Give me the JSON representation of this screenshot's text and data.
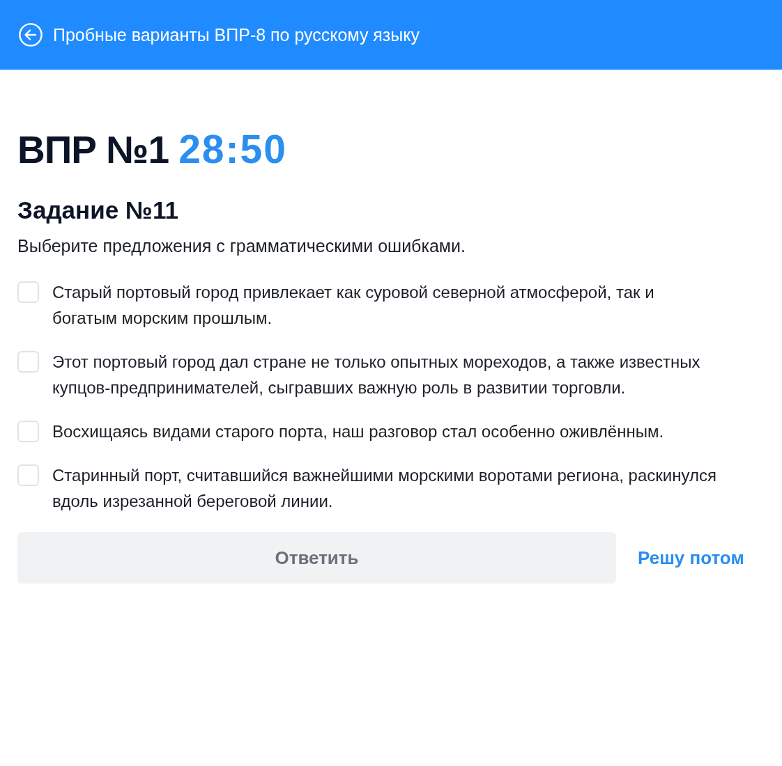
{
  "header": {
    "title": "Пробные варианты ВПР-8 по русскому языку"
  },
  "test": {
    "title": "ВПР №1",
    "timer": "28:50"
  },
  "task": {
    "title": "Задание №11",
    "instruction": "Выберите предложения с грамматическими ошибками."
  },
  "options": [
    {
      "text": "Старый портовый город привлекает как суровой северной атмосферой, так и богатым морским прошлым.",
      "checked": false
    },
    {
      "text": "Этот портовый город дал стране не только опытных мореходов, а также известных купцов-предпринимателей, сыгравших важную роль в развитии торговли.",
      "checked": false
    },
    {
      "text": "Восхищаясь видами старого порта, наш разговор стал особенно оживлённым.",
      "checked": false
    },
    {
      "text": "Старинный порт, считавшийся важнейшими морскими воротами региона, раскинулся вдоль изрезанной береговой линии.",
      "checked": false
    }
  ],
  "actions": {
    "submit": {
      "label": "Ответить",
      "disabled": true
    },
    "later": {
      "label": "Решу потом"
    }
  }
}
